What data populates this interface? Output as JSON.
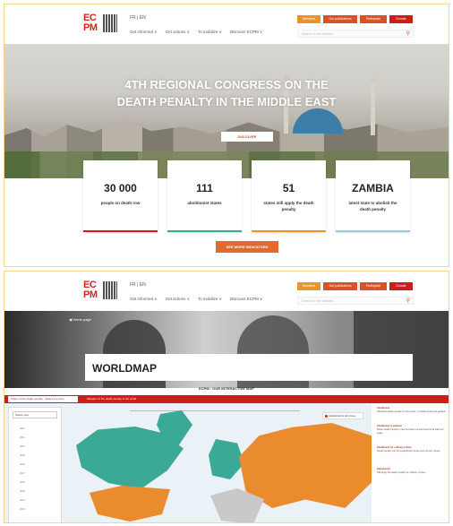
{
  "screen1": {
    "header": {
      "logo_text": "ECPM",
      "language": "FR | EN",
      "nav": [
        "Get informed  ∨",
        "Get actions  ∨",
        "To mobilize  ∨",
        "Discover ECPM  ∨"
      ],
      "buttons": [
        "Members",
        "Our publications",
        "Participate",
        "Donate"
      ],
      "search_placeholder": "Search on the website..."
    },
    "hero": {
      "title_line1": "4TH REGIONAL CONGRESS ON THE",
      "title_line2": "DEATH PENALTY IN THE MIDDLE EAST",
      "cta": "DISCOVER"
    },
    "stats": [
      {
        "number": "30 000",
        "label": "people on death row",
        "color": "#cc1f1a"
      },
      {
        "number": "111",
        "label": "abolitionist states",
        "color": "#3aa995"
      },
      {
        "number": "51",
        "label": "states still apply the death penalty",
        "color": "#e8952a"
      },
      {
        "number": "ZAMBIA",
        "label": "latest state to abolish the death penalty",
        "color": "#9ac9e3"
      }
    ],
    "more_button": "SEE MORE INDICATORS"
  },
  "screen2": {
    "header": {
      "logo_text": "ECPM",
      "language": "FR | EN",
      "nav": [
        "Get informed  ∨",
        "Get actions  ∨",
        "To mobilize  ∨",
        "Discover ECPM  ∨"
      ],
      "buttons": [
        "Members",
        "Our publications",
        "Participate",
        "Donate"
      ],
      "search_placeholder": "Search on the website..."
    },
    "breadcrumb": "◀  Home page",
    "page_title": "WORLDMAP",
    "subtitle": "ECPM · OUR INTERACTIVE MAP",
    "tabs": [
      "Status of the death penalty · Select a country",
      "Situation of the death penalty in the world"
    ],
    "filter": {
      "select": "Select year",
      "rows": [
        "2022",
        "2021",
        "2020",
        "2019",
        "2018",
        "2017",
        "2016",
        "2015",
        "2014",
        "2013"
      ]
    },
    "legend": "Abolitionist for all crimes",
    "side_notes": [
      {
        "heading": "Abolitionist",
        "text": "Abolished death penalty for all crimes, no death sentences applied."
      },
      {
        "heading": "Abolitionist in practice",
        "text": "Retain death penalty in law but have not executed for at least ten years."
      },
      {
        "heading": "Abolitionist for ordinary crimes",
        "text": "Death penalty only for exceptional crimes such as war crimes."
      },
      {
        "heading": "Retentionist",
        "text": "Still apply the death penalty for ordinary crimes."
      }
    ]
  },
  "colors": {
    "brand_red": "#cc1f1a",
    "orange": "#e8952a",
    "dark_orange": "#d9532a",
    "teal": "#3aa995",
    "light_blue": "#9ac9e3"
  }
}
